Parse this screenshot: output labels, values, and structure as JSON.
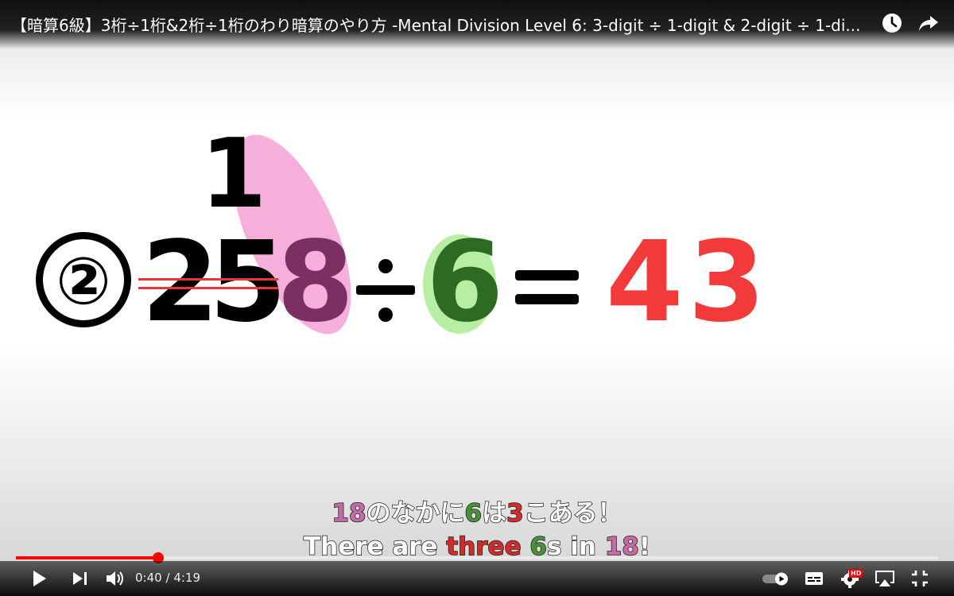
{
  "video": {
    "title": "【暗算6級】3桁÷1桁&2桁÷1桁のわり暗算のやり方 -Mental Division Level 6: 3-digit ÷ 1-digit & 2-digit ÷ 1-di...",
    "problem_number": "②",
    "carry_digit": "1",
    "dividend_digits": [
      "2",
      "5",
      "8"
    ],
    "divide_sign": "÷",
    "divisor": "6",
    "equals_sign": "=",
    "answer": "43",
    "subtitle_jp": {
      "part1": "18",
      "part2": "のなかに",
      "part3": "6",
      "part4": "は",
      "part5": "3",
      "part6": "こある！"
    },
    "subtitle_en": {
      "part1": "There are ",
      "part2": "three",
      "part3": " ",
      "part4": "6",
      "part5": "s in ",
      "part6": "18",
      "part7": "!"
    }
  },
  "player": {
    "current_time": "0:40",
    "duration": "4:19",
    "time_separator": "/",
    "progress_fraction": 0.154,
    "hd_badge": "HD",
    "accent_color": "#ff0000"
  },
  "colors": {
    "answer": "#f23a3a",
    "highlight_pink": "#f4a6d6",
    "highlight_green": "#b8eea4",
    "digit_dark_purple": "#7b2f62",
    "digit_dark_green": "#2e6b22"
  },
  "icons": [
    "watch-later-icon",
    "share-icon",
    "play-icon",
    "next-icon",
    "volume-icon",
    "autoplay-toggle-icon",
    "subtitles-icon",
    "settings-icon",
    "airplay-icon",
    "exit-fullscreen-icon"
  ]
}
